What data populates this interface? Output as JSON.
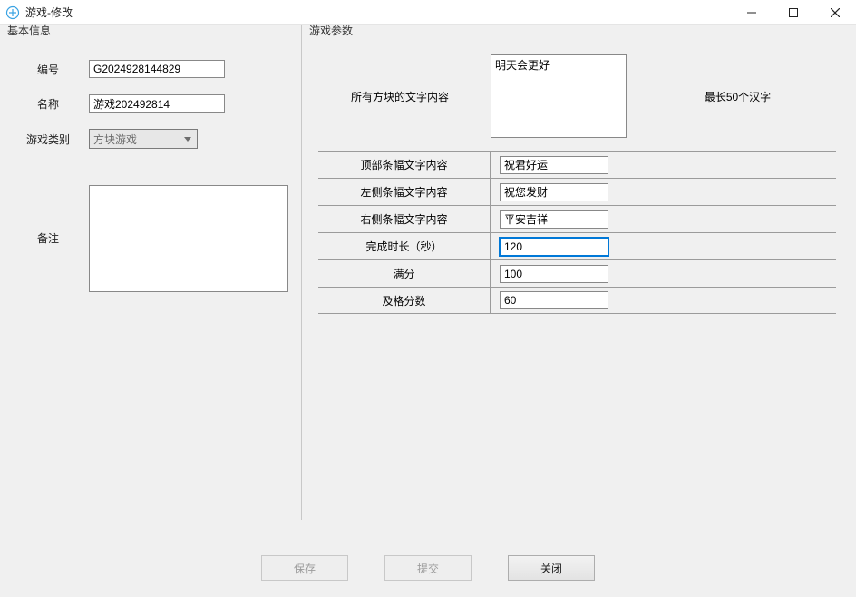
{
  "window": {
    "title": "游戏-修改"
  },
  "basic": {
    "title": "基本信息",
    "id_label": "编号",
    "id_value": "G2024928144829",
    "name_label": "名称",
    "name_value": "游戏202492814",
    "category_label": "游戏类别",
    "category_value": "方块游戏",
    "remark_label": "备注",
    "remark_value": ""
  },
  "params": {
    "title": "游戏参数",
    "all_blocks_label": "所有方块的文字内容",
    "all_blocks_value": "明天会更好",
    "all_blocks_hint": "最长50个汉字",
    "rows": [
      {
        "label": "顶部条幅文字内容",
        "value": "祝君好运"
      },
      {
        "label": "左侧条幅文字内容",
        "value": "祝您发财"
      },
      {
        "label": "右侧条幅文字内容",
        "value": "平安吉祥"
      },
      {
        "label": "完成时长（秒）",
        "value": "120",
        "focused": true
      },
      {
        "label": "满分",
        "value": "100"
      },
      {
        "label": "及格分数",
        "value": "60"
      }
    ]
  },
  "buttons": {
    "save": "保存",
    "submit": "提交",
    "close": "关闭"
  }
}
